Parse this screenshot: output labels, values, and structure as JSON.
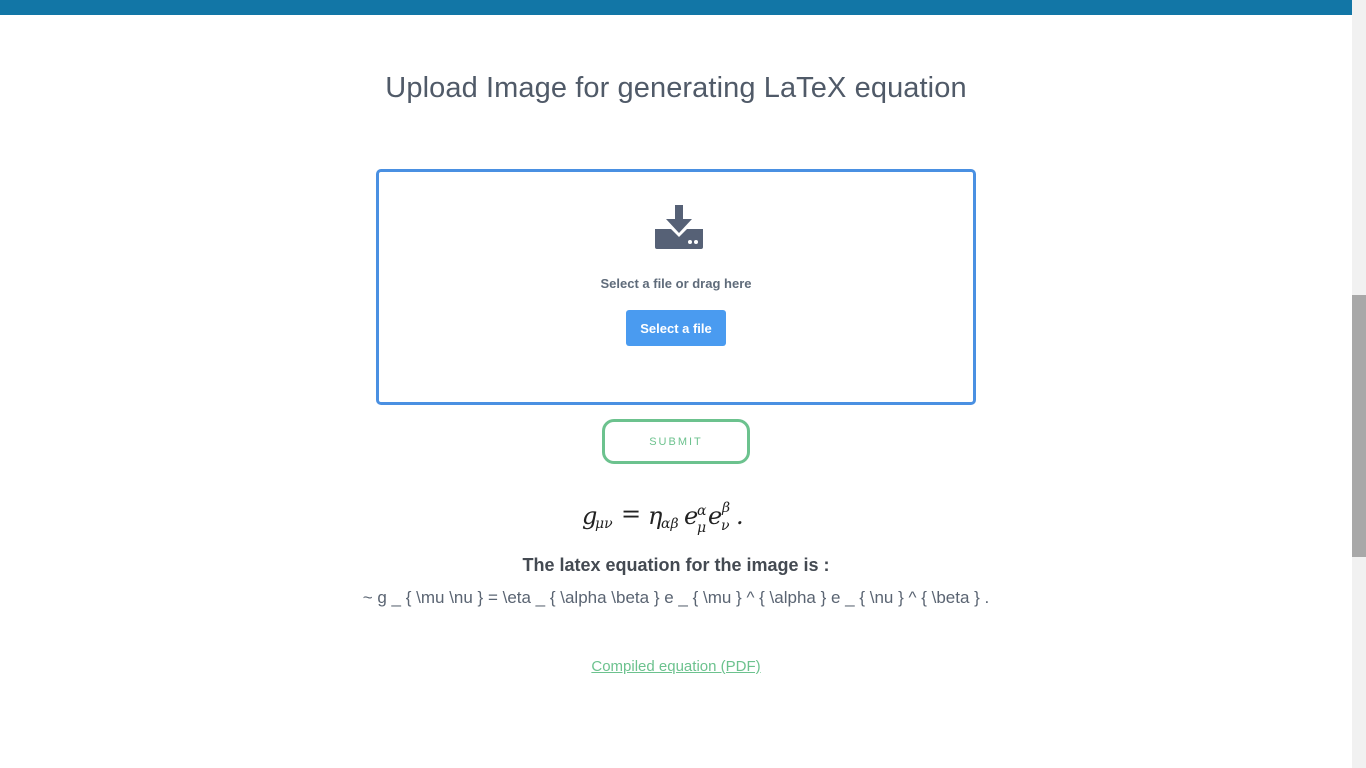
{
  "header": {
    "accent_color": "#1276a6"
  },
  "page": {
    "title": "Upload Image for generating LaTeX equation"
  },
  "upload": {
    "icon": "download-tray-icon",
    "prompt": "Select a file or drag here",
    "select_button_label": "Select a file",
    "border_color": "#4a90e2",
    "button_color": "#4a9bf0"
  },
  "submit": {
    "label": "SUBMIT",
    "color": "#6cc28e"
  },
  "result": {
    "heading": "The latex equation for the image is :",
    "latex": "~ g _ { \\mu \\nu } = \\eta _ { \\alpha \\beta } e _ { \\mu } ^ { \\alpha } e _ { \\nu } ^ { \\beta } .",
    "pdf_link_label": "Compiled equation (PDF)"
  }
}
